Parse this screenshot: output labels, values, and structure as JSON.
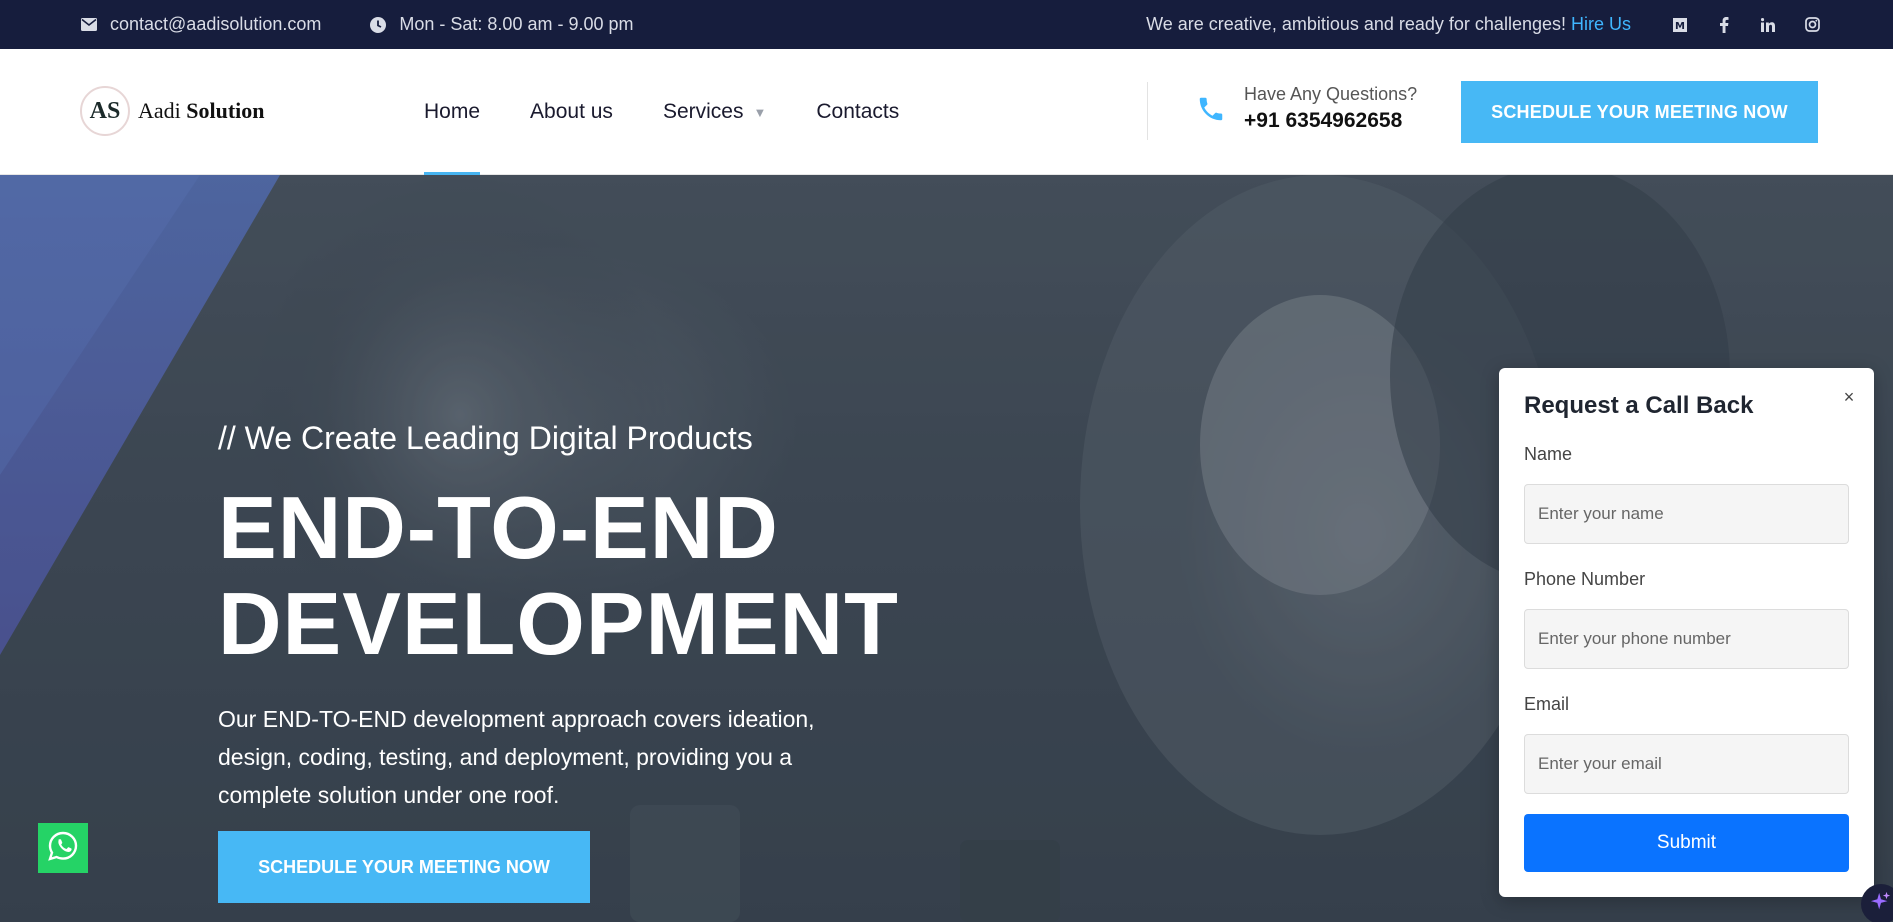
{
  "topbar": {
    "email": "contact@aadisolution.com",
    "hours": "Mon - Sat: 8.00 am - 9.00 pm",
    "tagline": "We are creative, ambitious and ready for challenges!",
    "hire_link": "Hire Us",
    "socials": [
      "medium-icon",
      "facebook-icon",
      "linkedin-icon",
      "instagram-icon"
    ]
  },
  "header": {
    "logo_mark": "AS",
    "logo_name_regular": "Aadi",
    "logo_name_bold": "Solution",
    "nav": [
      {
        "label": "Home",
        "active": true
      },
      {
        "label": "About us"
      },
      {
        "label": "Services"
      },
      {
        "label": "Contacts"
      }
    ],
    "phone_question": "Have Any Questions?",
    "phone_number": "+91 6354962658",
    "cta": "SCHEDULE YOUR MEETING NOW"
  },
  "hero": {
    "subtitle": "// We Create Leading Digital Products",
    "title_line1": "END-TO-END",
    "title_line2": "DEVELOPMENT",
    "description": "Our END-TO-END development approach covers ideation, design, coding, testing, and deployment, providing you a complete solution under one roof.",
    "cta": "SCHEDULE YOUR MEETING NOW"
  },
  "callback": {
    "title": "Request a Call Back",
    "name_label": "Name",
    "name_placeholder": "Enter your name",
    "phone_label": "Phone Number",
    "phone_placeholder": "Enter your phone number",
    "email_label": "Email",
    "email_placeholder": "Enter your email",
    "submit": "Submit"
  },
  "colors": {
    "topbar_bg": "#161d3d",
    "accent": "#47b8f5",
    "submit": "#0a73ff",
    "whatsapp": "#25d366"
  }
}
